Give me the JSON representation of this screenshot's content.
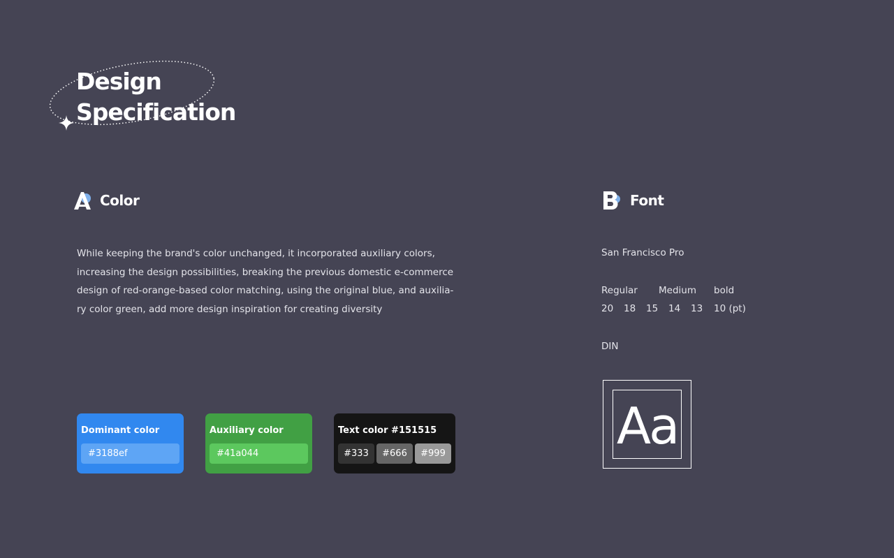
{
  "header": {
    "title_line1": "Design",
    "title_line2": "Specification",
    "decor": [
      "dotted-ellipse",
      "sparkle-icon"
    ]
  },
  "color_section": {
    "icon": "letter-a-icon",
    "heading": "Color",
    "paragraph": [
      "While keeping the brand's color unchanged, it incorporated auxiliary colors,",
      "increasing the design possibilities, breaking the previous domestic e-commerce",
      "design of red-orange-based color matching, using the original blue, and auxilia-",
      "ry color green, add more design inspiration for creating diversity"
    ],
    "cards": {
      "dominant": {
        "title": "Dominant color",
        "value": "#3188ef",
        "color": "#3188ef"
      },
      "auxiliary": {
        "title": "Auxiliary color",
        "value": "#41a044",
        "color": "#41a044"
      },
      "text": {
        "title": "Text color  #151515",
        "color": "#151515",
        "chips": [
          "#333",
          "#666",
          "#999"
        ]
      }
    }
  },
  "font_section": {
    "icon": "letter-b-icon",
    "heading": "Font",
    "family1": "San Francisco Pro",
    "weights": [
      "Regular",
      "Medium",
      "bold"
    ],
    "sizes": [
      "20",
      "18",
      "15",
      "14",
      "13",
      "10 (pt)"
    ],
    "family2": "DIN",
    "sample": "Aa"
  },
  "colors": {
    "background": "#454454",
    "accent_blue": "#3188ef",
    "accent_green": "#41a044"
  }
}
